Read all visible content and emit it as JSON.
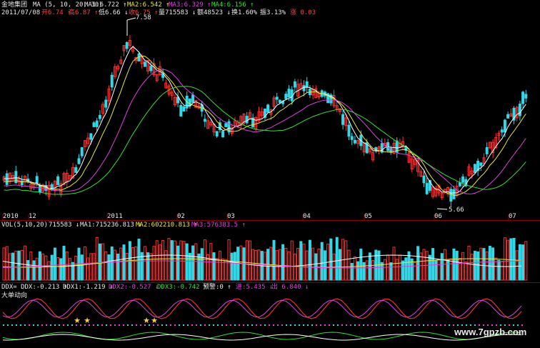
{
  "header": {
    "stock_name": "金地集团",
    "ma_label": "MA (5, 10, 20, 30)",
    "ma1": "MA1:6.722 ↑",
    "ma2": "MA2:6.542 ↑",
    "ma3": "MA3:6.329 ↑",
    "ma4": "MA4:6.156 ↑",
    "date": "2011/07/08",
    "open": "开6.74 ↑",
    "high": "高6.87 ↑",
    "low": "低6.66 ↓",
    "close": "收6.75 ↑",
    "volume": "量715583 ↓",
    "amount": "额48523 ↓",
    "turnover": "换1.60%",
    "amplitude": "振3.13%",
    "change": "涨 0.03"
  },
  "annotations": {
    "high_price": "7.58",
    "low_price": "5.66"
  },
  "x_axis": {
    "labels": [
      "2010",
      "12",
      "2011",
      "02",
      "03",
      "04",
      "05",
      "06",
      "07"
    ]
  },
  "vol_header": {
    "label": "VOL(5,10,20)",
    "vol": "715583 ↓",
    "ma1": "MA1:715236.813 ↓",
    "ma2": "MA2:602210.813 ↑",
    "ma3": "MA3:576383.5 ↑"
  },
  "ddx_header": {
    "ddx": "DDX= DDX:-0.213 ↑",
    "ddx1": "DDX1:-1.219 ↓",
    "ddx2": "DDX2:-0.527 ↓",
    "ddx3": "DDX3:-0.742 ↑",
    "alert": "预警:0 ↑",
    "enter": "进:5.435 ↓",
    "exit": "出 6.840 ↓"
  },
  "panel_title": "大单动向",
  "watermark": "www.7gpzb.com",
  "colors": {
    "up": "#ff3030",
    "down": "#30d8e8",
    "ma1": "#ffffff",
    "ma2": "#e8e830",
    "ma3": "#e040e0",
    "ma4": "#30e030",
    "grid": "#8a0000"
  }
}
